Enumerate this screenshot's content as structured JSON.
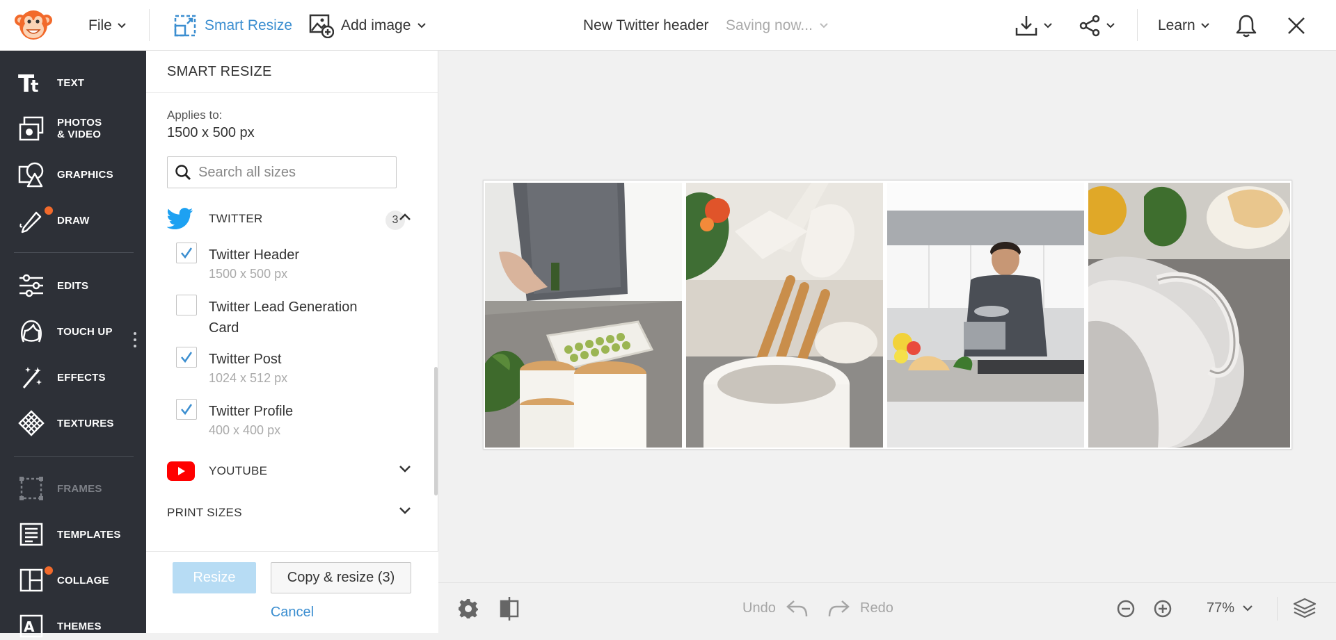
{
  "topbar": {
    "file_label": "File",
    "smart_resize_label": "Smart Resize",
    "add_image_label": "Add image",
    "document_title": "New Twitter header",
    "saving_status": "Saving now...",
    "learn_label": "Learn"
  },
  "leftnav": {
    "items": [
      {
        "label": "TEXT",
        "icon": "text-icon"
      },
      {
        "label_line1": "PHOTOS",
        "label_line2": "& VIDEO",
        "icon": "photos-icon"
      },
      {
        "label": "GRAPHICS",
        "icon": "graphics-icon"
      },
      {
        "label": "DRAW",
        "icon": "draw-icon"
      },
      {
        "label": "EDITS",
        "icon": "edits-icon"
      },
      {
        "label": "TOUCH UP",
        "icon": "touch-up-icon"
      },
      {
        "label": "EFFECTS",
        "icon": "effects-icon"
      },
      {
        "label": "TEXTURES",
        "icon": "textures-icon"
      },
      {
        "label": "FRAMES",
        "icon": "frames-icon"
      },
      {
        "label": "TEMPLATES",
        "icon": "templates-icon"
      },
      {
        "label": "COLLAGE",
        "icon": "collage-icon"
      },
      {
        "label": "THEMES",
        "icon": "themes-icon"
      }
    ]
  },
  "panel": {
    "title": "SMART RESIZE",
    "applies_label": "Applies to:",
    "applies_value": "1500 x 500 px",
    "search_placeholder": "Search all sizes",
    "groups": {
      "twitter": {
        "title": "TWITTER",
        "count": "3",
        "options": [
          {
            "name": "Twitter Header",
            "size": "1500 x 500 px",
            "checked": true
          },
          {
            "name": "Twitter Lead Generation Card",
            "size": "",
            "checked": false
          },
          {
            "name": "Twitter Post",
            "size": "1024 x 512 px",
            "checked": true
          },
          {
            "name": "Twitter Profile",
            "size": "400 x 400 px",
            "checked": true
          }
        ]
      },
      "youtube": {
        "title": "YOUTUBE"
      },
      "print": {
        "title": "PRINT SIZES"
      }
    },
    "resize_label": "Resize",
    "copy_resize_label": "Copy & resize (3)",
    "cancel_label": "Cancel"
  },
  "bottombar": {
    "undo_label": "Undo",
    "redo_label": "Redo",
    "zoom_value": "77%"
  },
  "colors": {
    "accent": "#3b8ed0",
    "sidebar_bg": "#2d3037",
    "notification_dot": "#f26a2b",
    "twitter_blue": "#1da1f2",
    "youtube_red": "#ff0000"
  }
}
